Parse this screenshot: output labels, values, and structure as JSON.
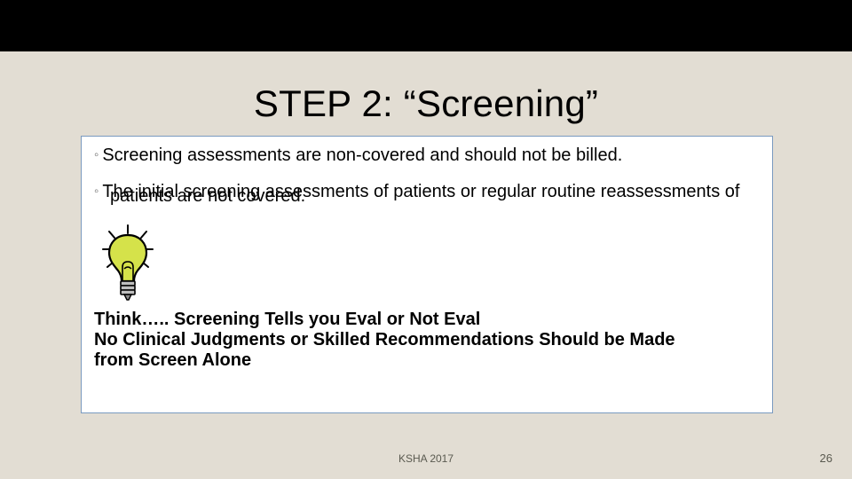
{
  "title": "STEP 2: “Screening”",
  "bullets": {
    "b1": "Screening assessments are non-covered and should not be billed.",
    "b2a": "The initial screening assessments of patients or regular routine reassessments of",
    "b2b": "patients are not covered."
  },
  "think": {
    "line1": "Think….. Screening Tells you Eval or Not Eval",
    "line2": "No Clinical Judgments or Skilled Recommendations Should be Made",
    "line3": "from Screen Alone"
  },
  "footer": {
    "center": "KSHA 2017",
    "page": "26"
  }
}
